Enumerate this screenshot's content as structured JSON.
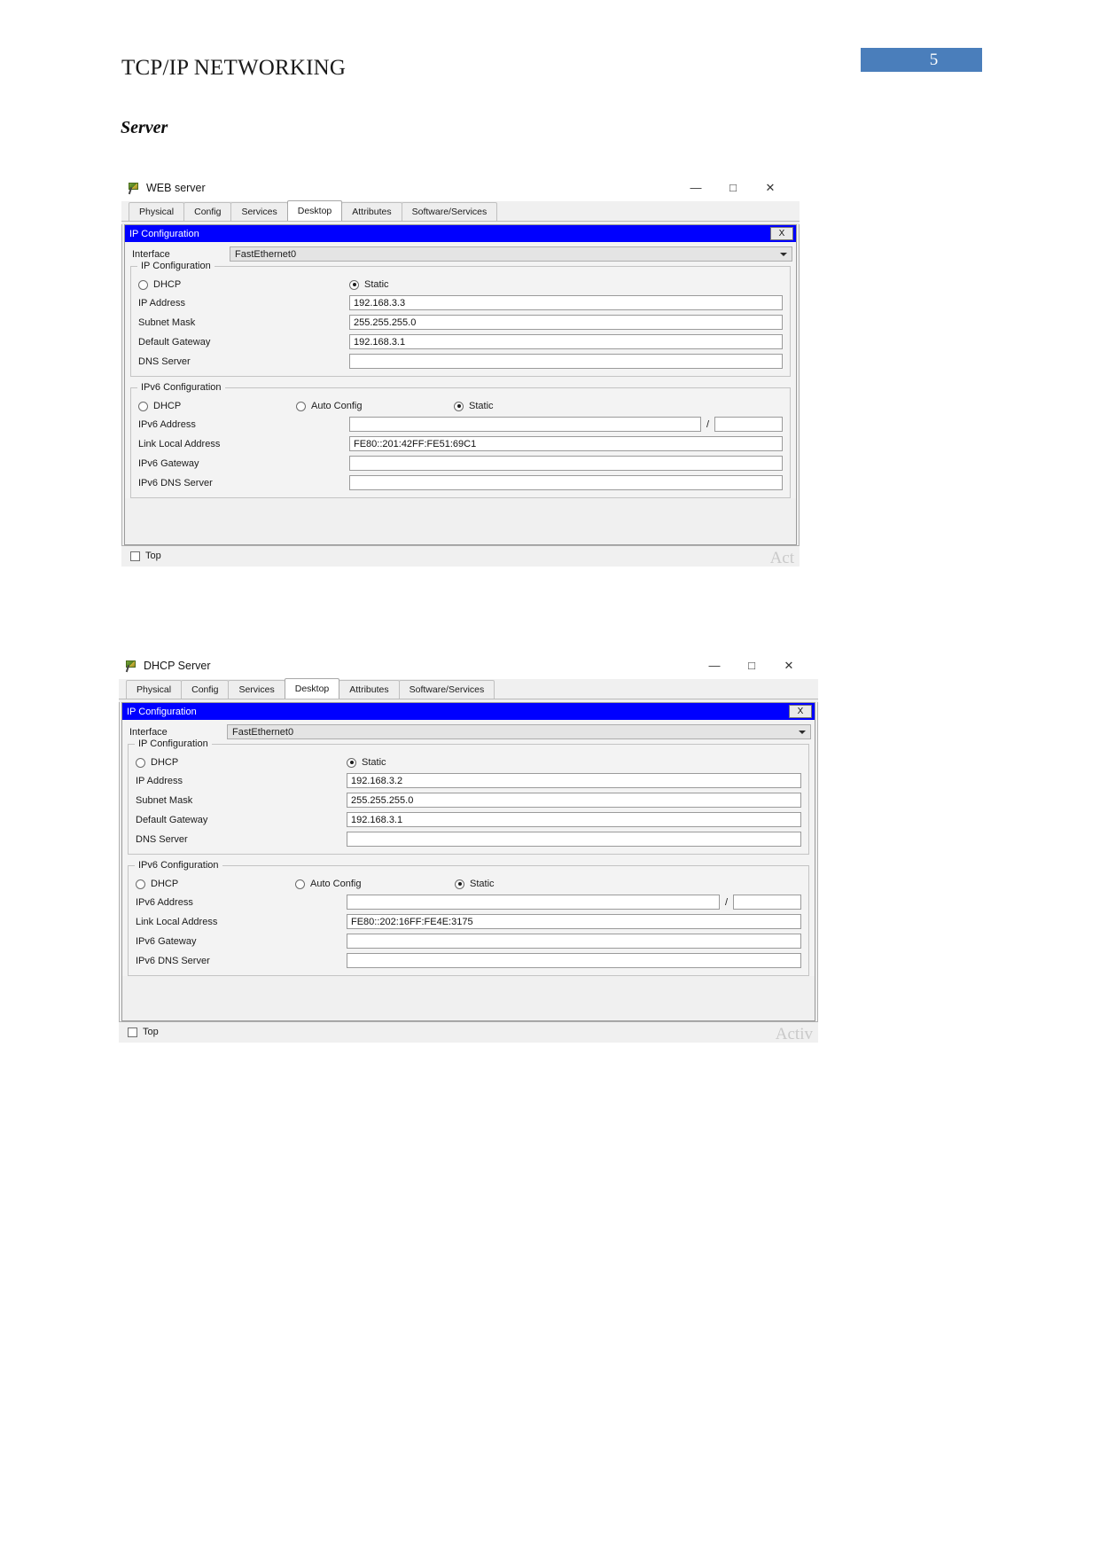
{
  "document": {
    "header_title": "TCP/IP NETWORKING",
    "page_number": "5",
    "section_title": "Server",
    "accent_color": "#4a7ebb"
  },
  "common": {
    "tabs": [
      "Physical",
      "Config",
      "Services",
      "Desktop",
      "Attributes",
      "Software/Services"
    ],
    "active_tab": "Desktop",
    "dialog_title": "IP Configuration",
    "close_label": "X",
    "interface_label": "Interface",
    "interface_value": "FastEthernet0",
    "ipv4_group_legend": "IP Configuration",
    "ipv6_group_legend": "IPv6 Configuration",
    "dhcp_label": "DHCP",
    "static_label": "Static",
    "auto_config_label": "Auto Config",
    "ip_address_label": "IP Address",
    "subnet_mask_label": "Subnet Mask",
    "default_gateway_label": "Default Gateway",
    "dns_server_label": "DNS Server",
    "ipv6_address_label": "IPv6 Address",
    "link_local_label": "Link Local Address",
    "ipv6_gateway_label": "IPv6 Gateway",
    "ipv6_dns_label": "IPv6 DNS Server",
    "slash": "/",
    "top_checkbox_label": "Top",
    "minimize_glyph": "—",
    "maximize_glyph": "□",
    "close_glyph": "✕",
    "titlebar_color": "#0000ff"
  },
  "window_web": {
    "title": "WEB server",
    "watermark": "Act",
    "ipv4": {
      "dhcp_selected": false,
      "static_selected": true,
      "ip_address": "192.168.3.3",
      "subnet_mask": "255.255.255.0",
      "default_gateway": "192.168.3.1",
      "dns_server": ""
    },
    "ipv6": {
      "dhcp_selected": false,
      "auto_config_selected": false,
      "static_selected": true,
      "ipv6_address": "",
      "prefix": "",
      "link_local_address": "FE80::201:42FF:FE51:69C1",
      "ipv6_gateway": "",
      "ipv6_dns_server": ""
    }
  },
  "window_dhcp": {
    "title": "DHCP Server",
    "watermark": "Activ",
    "ipv4": {
      "dhcp_selected": false,
      "static_selected": true,
      "ip_address": "192.168.3.2",
      "subnet_mask": "255.255.255.0",
      "default_gateway": "192.168.3.1",
      "dns_server": ""
    },
    "ipv6": {
      "dhcp_selected": false,
      "auto_config_selected": false,
      "static_selected": true,
      "ipv6_address": "",
      "prefix": "",
      "link_local_address": "FE80::202:16FF:FE4E:3175",
      "ipv6_gateway": "",
      "ipv6_dns_server": ""
    }
  }
}
